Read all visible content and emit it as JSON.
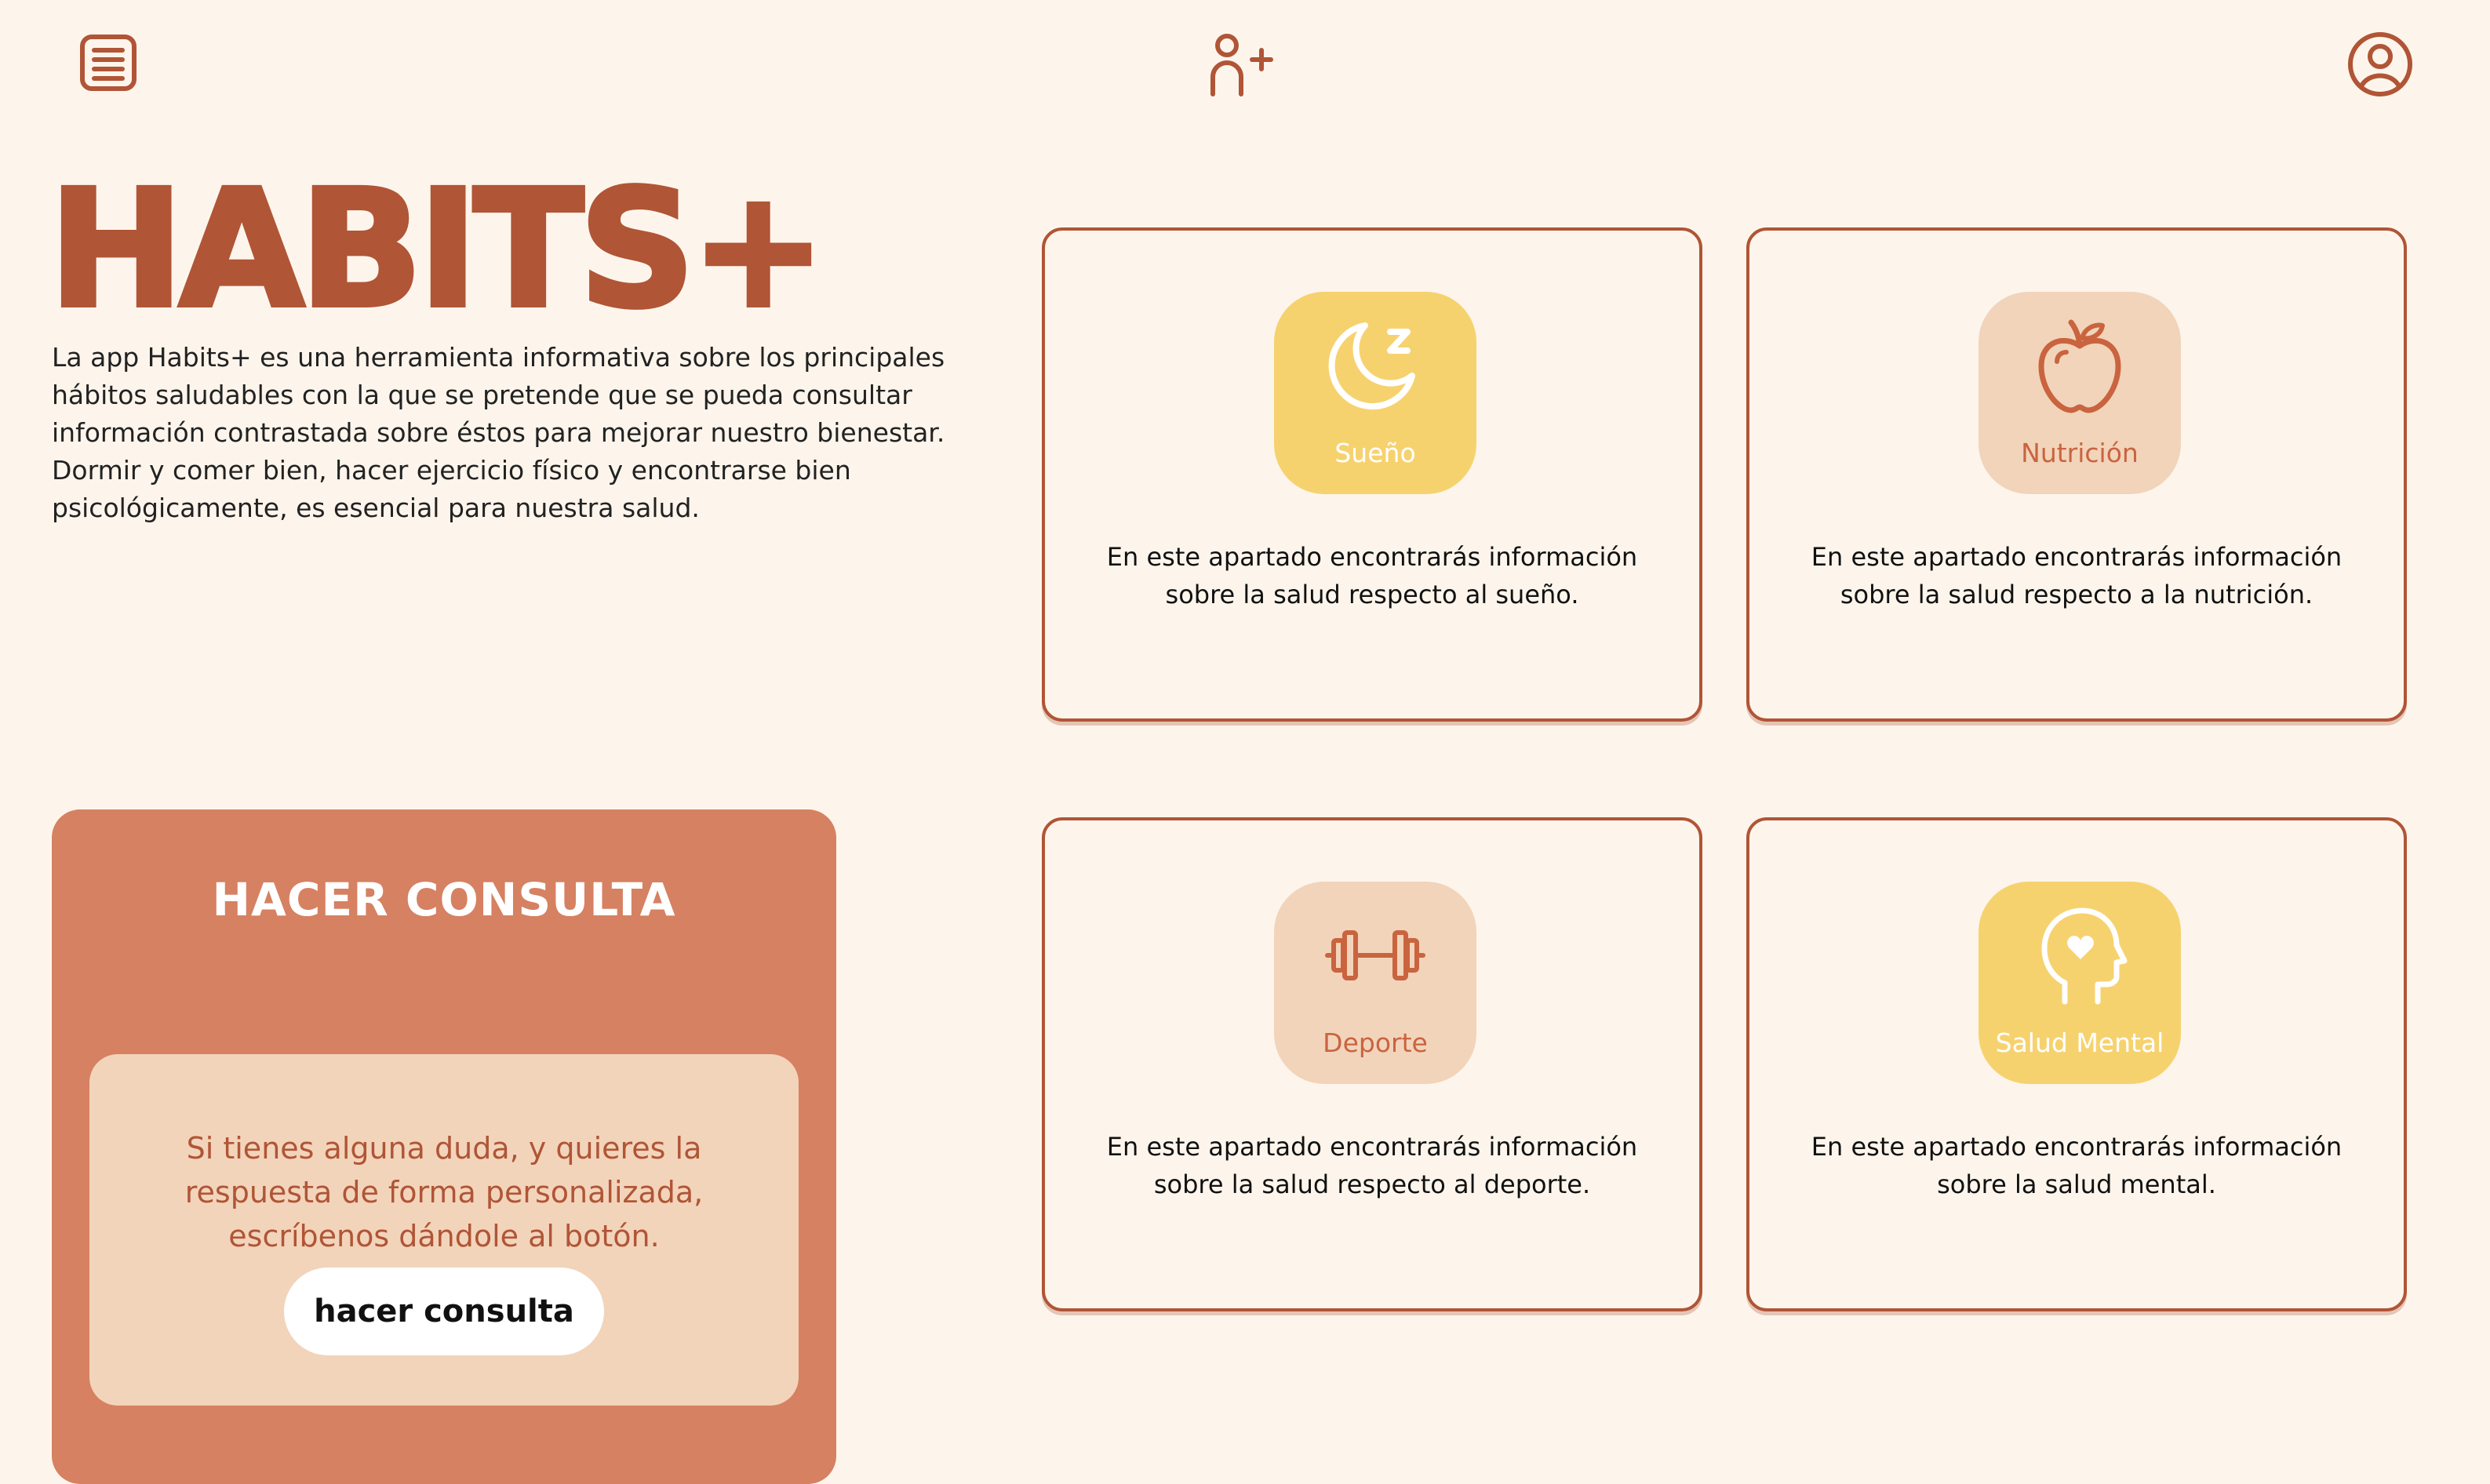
{
  "header": {
    "menu_icon": "menu-list-icon",
    "add_user_icon": "user-add-icon",
    "profile_icon": "user-circle-icon"
  },
  "brand": {
    "title": "HABITS+",
    "description": "La app Habits+ es una herramienta informativa sobre los principales hábitos saludables con la que se pretende que se pueda consultar información contrastada sobre éstos para mejorar nuestro bienestar. Dormir y comer bien, hacer ejercicio físico y encontrarse bien psicológicamente, es esencial para nuestra salud."
  },
  "categories": [
    {
      "label": "Sueño",
      "icon": "moon-sleep-icon",
      "color": "#f6d26f",
      "description": "En este apartado encontrarás información sobre la salud respecto al sueño."
    },
    {
      "label": "Nutrición",
      "icon": "apple-icon",
      "color": "#f2d4bb",
      "description": "En este apartado encontrarás información sobre la salud respecto a la nutrición."
    },
    {
      "label": "Deporte",
      "icon": "dumbbell-icon",
      "color": "#f2d4bb",
      "description": "En este apartado encontrarás información sobre la salud respecto al deporte."
    },
    {
      "label": "Salud Mental",
      "icon": "head-heart-icon",
      "color": "#f6d26f",
      "description": "En este apartado encontrarás información sobre la salud mental."
    }
  ],
  "consulta": {
    "title": "HACER CONSULTA",
    "text": "Si tienes alguna duda, y quieres la respuesta de forma personalizada, escríbenos dándole al botón.",
    "button_label": "hacer consulta"
  },
  "colors": {
    "background": "#fdf5ec",
    "brand": "#b05536",
    "yellow": "#f6d26f",
    "peach": "#f2d4bb",
    "consult_panel": "#d68162"
  }
}
